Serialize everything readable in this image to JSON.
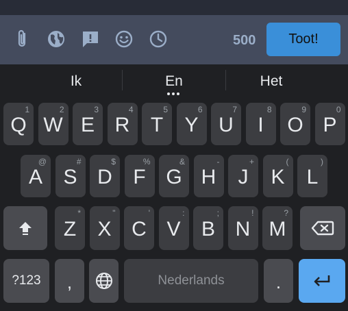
{
  "compose": {
    "icons": [
      "paperclip-icon",
      "globe-icon",
      "content-warning-icon",
      "emoji-icon",
      "clock-icon"
    ],
    "char_count": "500",
    "submit_label": "Toot!",
    "colors": {
      "bar": "#444b5d",
      "button": "#3a8fd9",
      "counter": "#9baec8"
    }
  },
  "keyboard": {
    "suggestions": [
      "Ik",
      "En",
      "Het"
    ],
    "row1": [
      {
        "label": "Q",
        "hint": "1"
      },
      {
        "label": "W",
        "hint": "2"
      },
      {
        "label": "E",
        "hint": "3"
      },
      {
        "label": "R",
        "hint": "4"
      },
      {
        "label": "T",
        "hint": "5"
      },
      {
        "label": "Y",
        "hint": "6"
      },
      {
        "label": "U",
        "hint": "7"
      },
      {
        "label": "I",
        "hint": "8"
      },
      {
        "label": "O",
        "hint": "9"
      },
      {
        "label": "P",
        "hint": "0"
      }
    ],
    "row2": [
      {
        "label": "A",
        "hint": "@"
      },
      {
        "label": "S",
        "hint": "#"
      },
      {
        "label": "D",
        "hint": "$"
      },
      {
        "label": "F",
        "hint": "%"
      },
      {
        "label": "G",
        "hint": "&"
      },
      {
        "label": "H",
        "hint": "-"
      },
      {
        "label": "J",
        "hint": "+"
      },
      {
        "label": "K",
        "hint": "("
      },
      {
        "label": "L",
        "hint": ")"
      }
    ],
    "row3": [
      {
        "label": "Z",
        "hint": "*"
      },
      {
        "label": "X",
        "hint": "\""
      },
      {
        "label": "C",
        "hint": "'"
      },
      {
        "label": "V",
        "hint": ":"
      },
      {
        "label": "B",
        "hint": ";"
      },
      {
        "label": "N",
        "hint": "!"
      },
      {
        "label": "M",
        "hint": "?"
      }
    ],
    "symbols_label": "?123",
    "comma_label": ",",
    "space_label": "Nederlands",
    "period_label": ".",
    "colors": {
      "key": "#3c3d41",
      "function_key": "#4a4b50",
      "enter": "#5aa8f0",
      "background": "#1f2023"
    }
  }
}
